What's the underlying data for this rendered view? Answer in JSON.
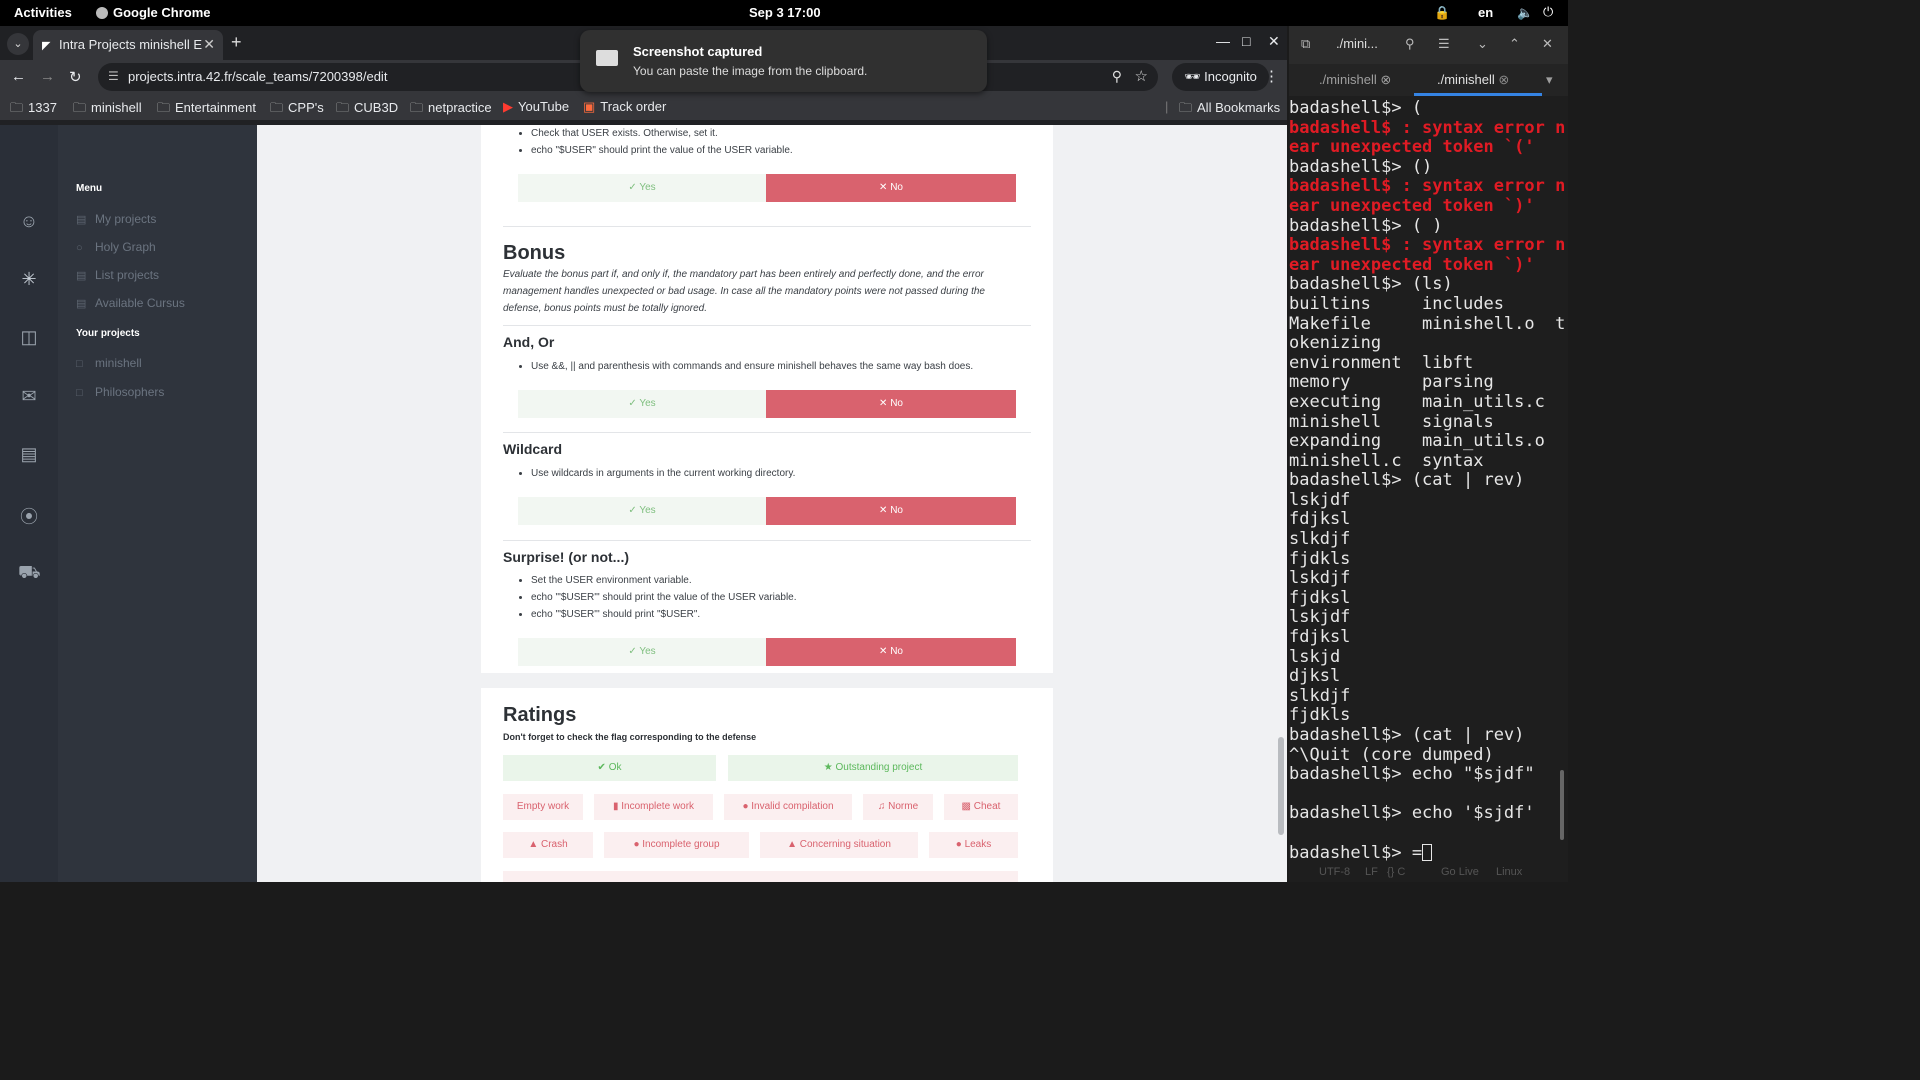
{
  "topbar": {
    "activities": "Activities",
    "app_name": "Google Chrome",
    "clock": "Sep 3  17:00",
    "lang": "en"
  },
  "chrome": {
    "tab_title": "Intra Projects minishell E",
    "url": "projects.intra.42.fr/scale_teams/7200398/edit",
    "incognito": "Incognito",
    "bookmarks": [
      "1337",
      "minishell",
      "Entertainment",
      "CPP's",
      "CUB3D",
      "netpractice",
      "YouTube",
      "Track order"
    ],
    "all_bookmarks": "All Bookmarks"
  },
  "notification": {
    "title": "Screenshot captured",
    "body": "You can paste the image from the clipboard."
  },
  "sidebar": {
    "menu_header": "Menu",
    "menu_items": [
      "My projects",
      "Holy Graph",
      "List projects",
      "Available Cursus"
    ],
    "projects_header": "Your projects",
    "projects": [
      "minishell",
      "Philosophers"
    ]
  },
  "evaluation": {
    "env_bullets": [
      "Check that USER exists. Otherwise, set it.",
      "echo \"$USER\" should print the value of the USER variable."
    ],
    "yes_label": "Yes",
    "no_label": "No",
    "bonus_title": "Bonus",
    "bonus_desc": "Evaluate the bonus part if, and only if, the mandatory part has been entirely and perfectly done, and the error management handles unexpected or bad usage. In case all the mandatory points were not passed during the defense, bonus points must be totally ignored.",
    "andor_title": "And, Or",
    "andor_bullets": [
      "Use &&, || and parenthesis with commands and ensure minishell behaves the same way bash does."
    ],
    "wildcard_title": "Wildcard",
    "wildcard_bullets": [
      "Use wildcards in arguments in the current working directory."
    ],
    "surprise_title": "Surprise! (or not...)",
    "surprise_bullets": [
      "Set the USER environment variable.",
      "echo \"'$USER'\" should print the value of the USER variable.",
      "echo '\"$USER\"' should print \"$USER\"."
    ]
  },
  "ratings": {
    "title": "Ratings",
    "subtitle": "Don't forget to check the flag corresponding to the defense",
    "ok": "Ok",
    "outstanding": "Outstanding project",
    "flags_row1": [
      "Empty work",
      "Incomplete work",
      "Invalid compilation",
      "Norme",
      "Cheat"
    ],
    "flags_row2": [
      "Crash",
      "Incomplete group",
      "Concerning situation",
      "Leaks"
    ]
  },
  "terminal": {
    "title": "./mini...",
    "tabs": [
      "./minishell",
      "./minishell"
    ],
    "lines": [
      {
        "t": "badashell$> (",
        "c": "n"
      },
      {
        "t": "badashell$ : syntax error n",
        "c": "e"
      },
      {
        "t": "ear unexpected token `('",
        "c": "e"
      },
      {
        "t": "badashell$> ()",
        "c": "n"
      },
      {
        "t": "badashell$ : syntax error n",
        "c": "e"
      },
      {
        "t": "ear unexpected token `)'",
        "c": "e"
      },
      {
        "t": "badashell$> ( )",
        "c": "n"
      },
      {
        "t": "badashell$ : syntax error n",
        "c": "e"
      },
      {
        "t": "ear unexpected token `)'",
        "c": "e"
      },
      {
        "t": "badashell$> (ls)",
        "c": "n"
      },
      {
        "t": "builtins     includes",
        "c": "n"
      },
      {
        "t": "Makefile     minishell.o  t",
        "c": "n"
      },
      {
        "t": "okenizing",
        "c": "n"
      },
      {
        "t": "environment  libft",
        "c": "n"
      },
      {
        "t": "memory       parsing",
        "c": "n"
      },
      {
        "t": "executing    main_utils.c",
        "c": "n"
      },
      {
        "t": "minishell    signals",
        "c": "n"
      },
      {
        "t": "expanding    main_utils.o",
        "c": "n"
      },
      {
        "t": "minishell.c  syntax",
        "c": "n"
      },
      {
        "t": "badashell$> (cat | rev)",
        "c": "n"
      },
      {
        "t": "lskjdf",
        "c": "n"
      },
      {
        "t": "fdjksl",
        "c": "n"
      },
      {
        "t": "slkdjf",
        "c": "n"
      },
      {
        "t": "fjdkls",
        "c": "n"
      },
      {
        "t": "lskdjf",
        "c": "n"
      },
      {
        "t": "fjdksl",
        "c": "n"
      },
      {
        "t": "lskjdf",
        "c": "n"
      },
      {
        "t": "fdjksl",
        "c": "n"
      },
      {
        "t": "lskjd",
        "c": "n"
      },
      {
        "t": "djksl",
        "c": "n"
      },
      {
        "t": "slkdjf",
        "c": "n"
      },
      {
        "t": "fjdkls",
        "c": "n"
      },
      {
        "t": "badashell$> (cat | rev)",
        "c": "n"
      },
      {
        "t": "^\\Quit (core dumped)",
        "c": "n"
      },
      {
        "t": "badashell$> echo \"$sjdf\"",
        "c": "n"
      },
      {
        "t": "",
        "c": "n"
      },
      {
        "t": "badashell$> echo '$sjdf'",
        "c": "n"
      },
      {
        "t": "",
        "c": "n"
      },
      {
        "t": "badashell$> =",
        "c": "cur"
      }
    ],
    "status": [
      "UTF-8",
      "LF",
      "{} C",
      "Go Live",
      "Linux"
    ]
  }
}
